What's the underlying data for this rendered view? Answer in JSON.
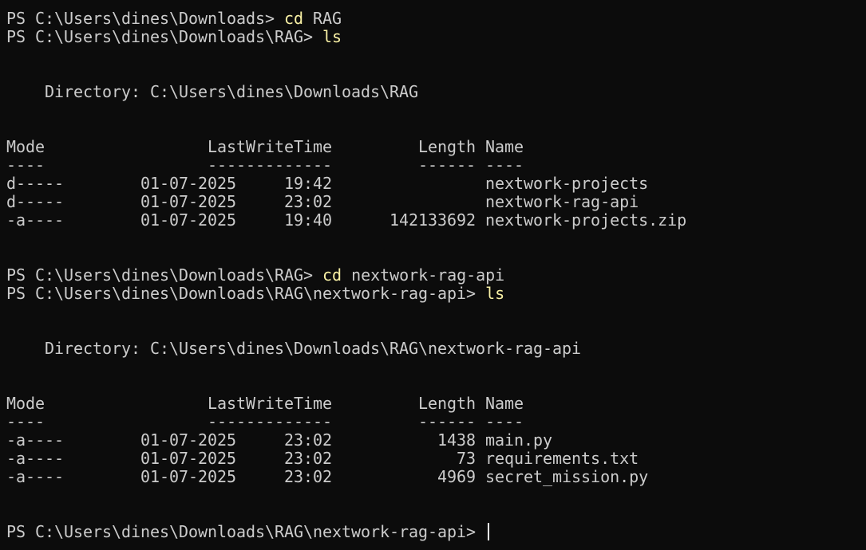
{
  "terminal": {
    "blocks": [
      {
        "prompt": "PS C:\\Users\\dines\\Downloads> ",
        "command": "cd",
        "args": " RAG"
      },
      {
        "prompt": "PS C:\\Users\\dines\\Downloads\\RAG> ",
        "command": "ls",
        "args": ""
      },
      {
        "directory": "    Directory: C:\\Users\\dines\\Downloads\\RAG"
      },
      {
        "header": "Mode                 LastWriteTime         Length Name"
      },
      {
        "underline": "----                 -------------         ------ ----"
      },
      {
        "rows": [
          "d-----        01-07-2025     19:42                nextwork-projects",
          "d-----        01-07-2025     23:02                nextwork-rag-api",
          "-a----        01-07-2025     19:40      142133692 nextwork-projects.zip"
        ]
      },
      {
        "prompt": "PS C:\\Users\\dines\\Downloads\\RAG> ",
        "command": "cd",
        "args": " nextwork-rag-api"
      },
      {
        "prompt": "PS C:\\Users\\dines\\Downloads\\RAG\\nextwork-rag-api> ",
        "command": "ls",
        "args": ""
      },
      {
        "directory": "    Directory: C:\\Users\\dines\\Downloads\\RAG\\nextwork-rag-api"
      },
      {
        "header": "Mode                 LastWriteTime         Length Name"
      },
      {
        "underline": "----                 -------------         ------ ----"
      },
      {
        "rows": [
          "-a----        01-07-2025     23:02           1438 main.py",
          "-a----        01-07-2025     23:02             73 requirements.txt",
          "-a----        01-07-2025     23:02           4969 secret_mission.py"
        ]
      },
      {
        "prompt": "PS C:\\Users\\dines\\Downloads\\RAG\\nextwork-rag-api> ",
        "command": "",
        "args": ""
      }
    ]
  },
  "terminal_lines": {
    "l01_prompt": "PS C:\\Users\\dines\\Downloads> ",
    "l01_cmd": "cd",
    "l01_args": " RAG",
    "l02_prompt": "PS C:\\Users\\dines\\Downloads\\RAG> ",
    "l02_cmd": "ls",
    "l05_dir": "    Directory: C:\\Users\\dines\\Downloads\\RAG",
    "l08_header": "Mode                 LastWriteTime         Length Name",
    "l09_underline": "----                 -------------         ------ ----",
    "l10_row": "d-----        01-07-2025     19:42                nextwork-projects",
    "l11_row": "d-----        01-07-2025     23:02                nextwork-rag-api",
    "l12_row": "-a----        01-07-2025     19:40      142133692 nextwork-projects.zip",
    "l15_prompt": "PS C:\\Users\\dines\\Downloads\\RAG> ",
    "l15_cmd": "cd",
    "l15_args": " nextwork-rag-api",
    "l16_prompt": "PS C:\\Users\\dines\\Downloads\\RAG\\nextwork-rag-api> ",
    "l16_cmd": "ls",
    "l19_dir": "    Directory: C:\\Users\\dines\\Downloads\\RAG\\nextwork-rag-api",
    "l22_header": "Mode                 LastWriteTime         Length Name",
    "l23_underline": "----                 -------------         ------ ----",
    "l24_row": "-a----        01-07-2025     23:02           1438 main.py",
    "l25_row": "-a----        01-07-2025     23:02             73 requirements.txt",
    "l26_row": "-a----        01-07-2025     23:02           4969 secret_mission.py",
    "l29_prompt": "PS C:\\Users\\dines\\Downloads\\RAG\\nextwork-rag-api> "
  },
  "colors": {
    "background": "#0c0c0c",
    "foreground": "#cccccc",
    "command": "#f9f1a5",
    "cursor": "#ffffff"
  }
}
